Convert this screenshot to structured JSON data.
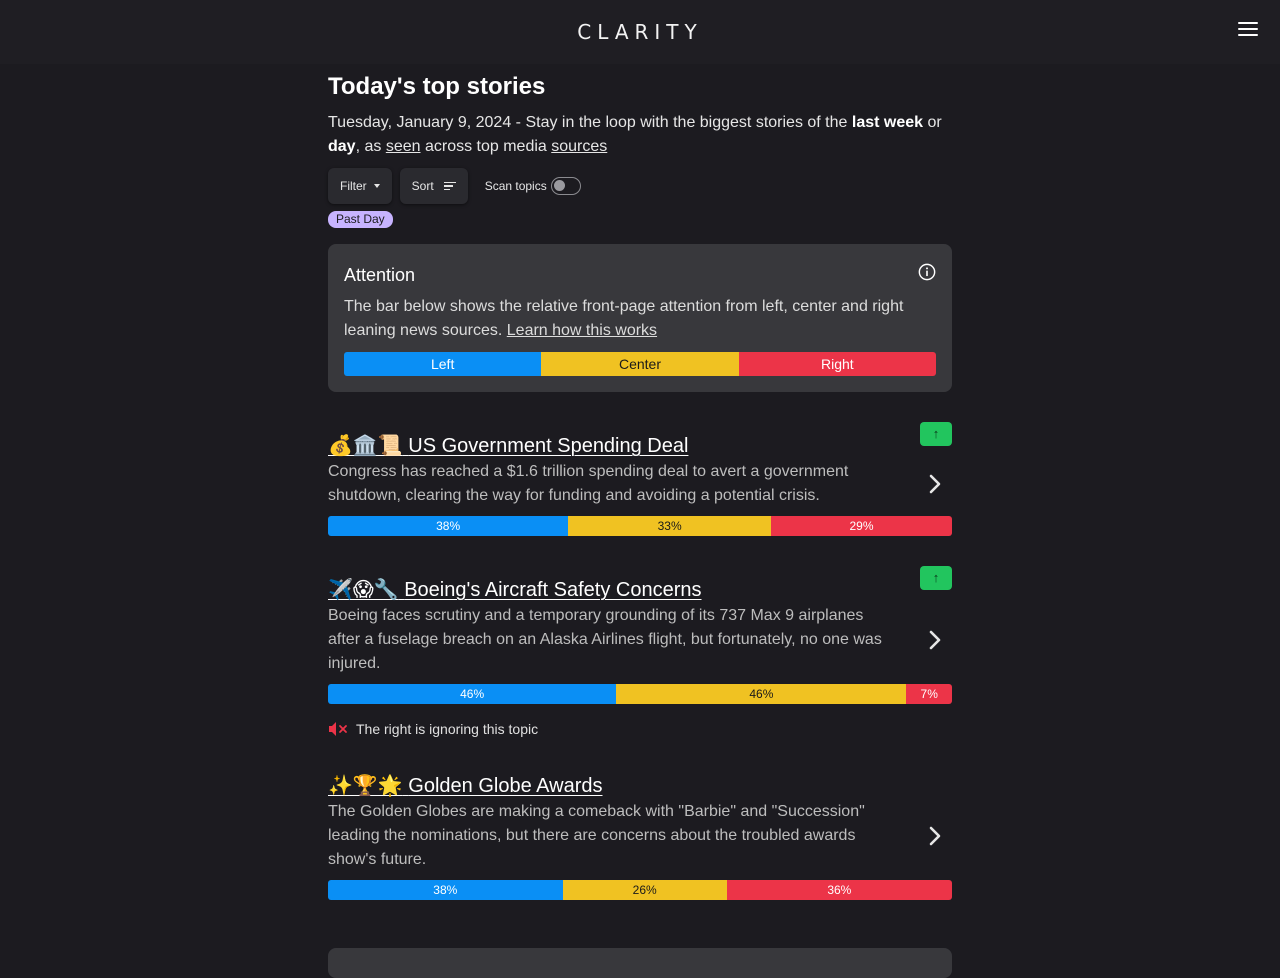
{
  "header": {
    "logo": "CLARITY",
    "menu_icon": "hamburger-menu-icon"
  },
  "page": {
    "title": "Today's top stories",
    "subtitle": {
      "date": "Tuesday, January 9, 2024",
      "text_a": " - Stay in the loop with the biggest stories of the ",
      "link_week": "last week",
      "text_b": " or ",
      "link_day": "day",
      "text_c": ", as ",
      "link_seen": "seen",
      "text_d": " across top media ",
      "link_sources": "sources"
    }
  },
  "controls": {
    "filter_label": "Filter",
    "sort_label": "Sort",
    "scan_label": "Scan topics",
    "scan_on": false
  },
  "active_filter": "Past Day",
  "attention": {
    "title": "Attention",
    "description": "The bar below shows the relative front-page attention from left, center and right leaning news sources.",
    "learn_link": "Learn how this works",
    "left_label": "Left",
    "center_label": "Center",
    "right_label": "Right"
  },
  "colors": {
    "left": "#0a8ff5",
    "center": "#f0c222",
    "right": "#ec3448",
    "trend": "#22c55e",
    "chip": "#c7b3ff"
  },
  "stories": [
    {
      "emoji": "💰🏛️📜",
      "title": "US Government Spending Deal",
      "description": "Congress has reached a $1.6 trillion spending deal to avert a government shutdown, clearing the way for funding and avoiding a potential crisis.",
      "trend": "↑",
      "left": "38%",
      "center": "33%",
      "right": "29%",
      "left_value": 38,
      "center_value": 33,
      "right_value": 29
    },
    {
      "emoji": "✈️😱🔧",
      "title": "Boeing's Aircraft Safety Concerns",
      "description": "Boeing faces scrutiny and a temporary grounding of its 737 Max 9 airplanes after a fuselage breach on an Alaska Airlines flight, but fortunately, no one was injured.",
      "trend": "↑",
      "left": "46%",
      "center": "46%",
      "right": "7%",
      "left_value": 46,
      "center_value": 46,
      "right_value": 7,
      "ignore_note": "The right is ignoring this topic"
    },
    {
      "emoji": "✨🏆🌟",
      "title": "Golden Globe Awards",
      "description": "The Golden Globes are making a comeback with \"Barbie\" and \"Succession\" leading the nominations, but there are concerns about the troubled awards show's future.",
      "left": "38%",
      "center": "26%",
      "right": "36%",
      "left_value": 38,
      "center_value": 26,
      "right_value": 36
    }
  ]
}
